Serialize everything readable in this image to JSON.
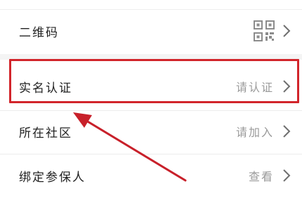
{
  "rows": [
    {
      "label": "二维码",
      "value": "",
      "icon": "qr-code-icon"
    },
    {
      "label": "实名认证",
      "value": "请认证",
      "icon": "chevron-right-icon"
    },
    {
      "label": "所在社区",
      "value": "请加入",
      "icon": "chevron-right-icon"
    },
    {
      "label": "绑定参保人",
      "value": "查看",
      "icon": "chevron-right-icon"
    }
  ],
  "annotation": {
    "highlight_color": "#d2252b",
    "arrow_color": "#c8202a"
  }
}
